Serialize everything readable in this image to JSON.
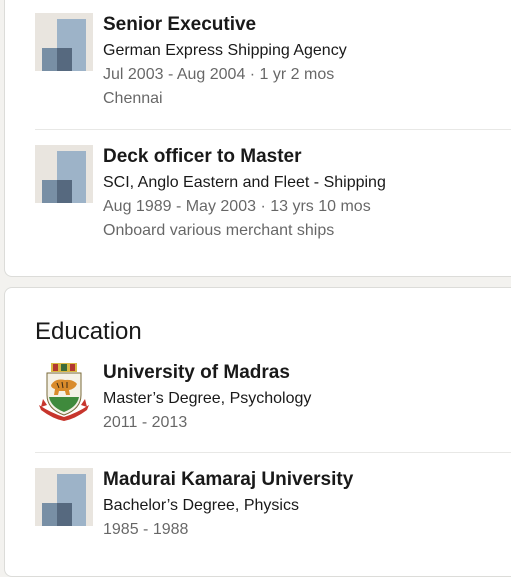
{
  "experience": {
    "items": [
      {
        "title": "Senior Executive",
        "company": "German Express Shipping Agency",
        "dates": "Jul 2003 - Aug 2004 · 1 yr 2 mos",
        "location": "Chennai",
        "logo": "company-placeholder-icon"
      },
      {
        "title": "Deck officer to Master",
        "company": "SCI, Anglo Eastern and Fleet - Shipping",
        "dates": "Aug 1989 - May 2003 · 13 yrs 10 mos",
        "location": "Onboard various merchant ships",
        "logo": "company-placeholder-icon"
      }
    ]
  },
  "education": {
    "heading": "Education",
    "items": [
      {
        "school": "University of Madras",
        "degree": "Master’s Degree, Psychology",
        "years": "2011 - 2013",
        "logo": "university-seal-icon"
      },
      {
        "school": "Madurai Kamaraj University",
        "degree": "Bachelor’s Degree, Physics",
        "years": "1985 - 1988",
        "logo": "company-placeholder-icon"
      }
    ]
  },
  "colors": {
    "page_bg": "#f3f2ef",
    "card_bg": "#ffffff",
    "muted_text": "#666666",
    "logo_light": "#9db3c8",
    "logo_dark": "#56697f"
  }
}
